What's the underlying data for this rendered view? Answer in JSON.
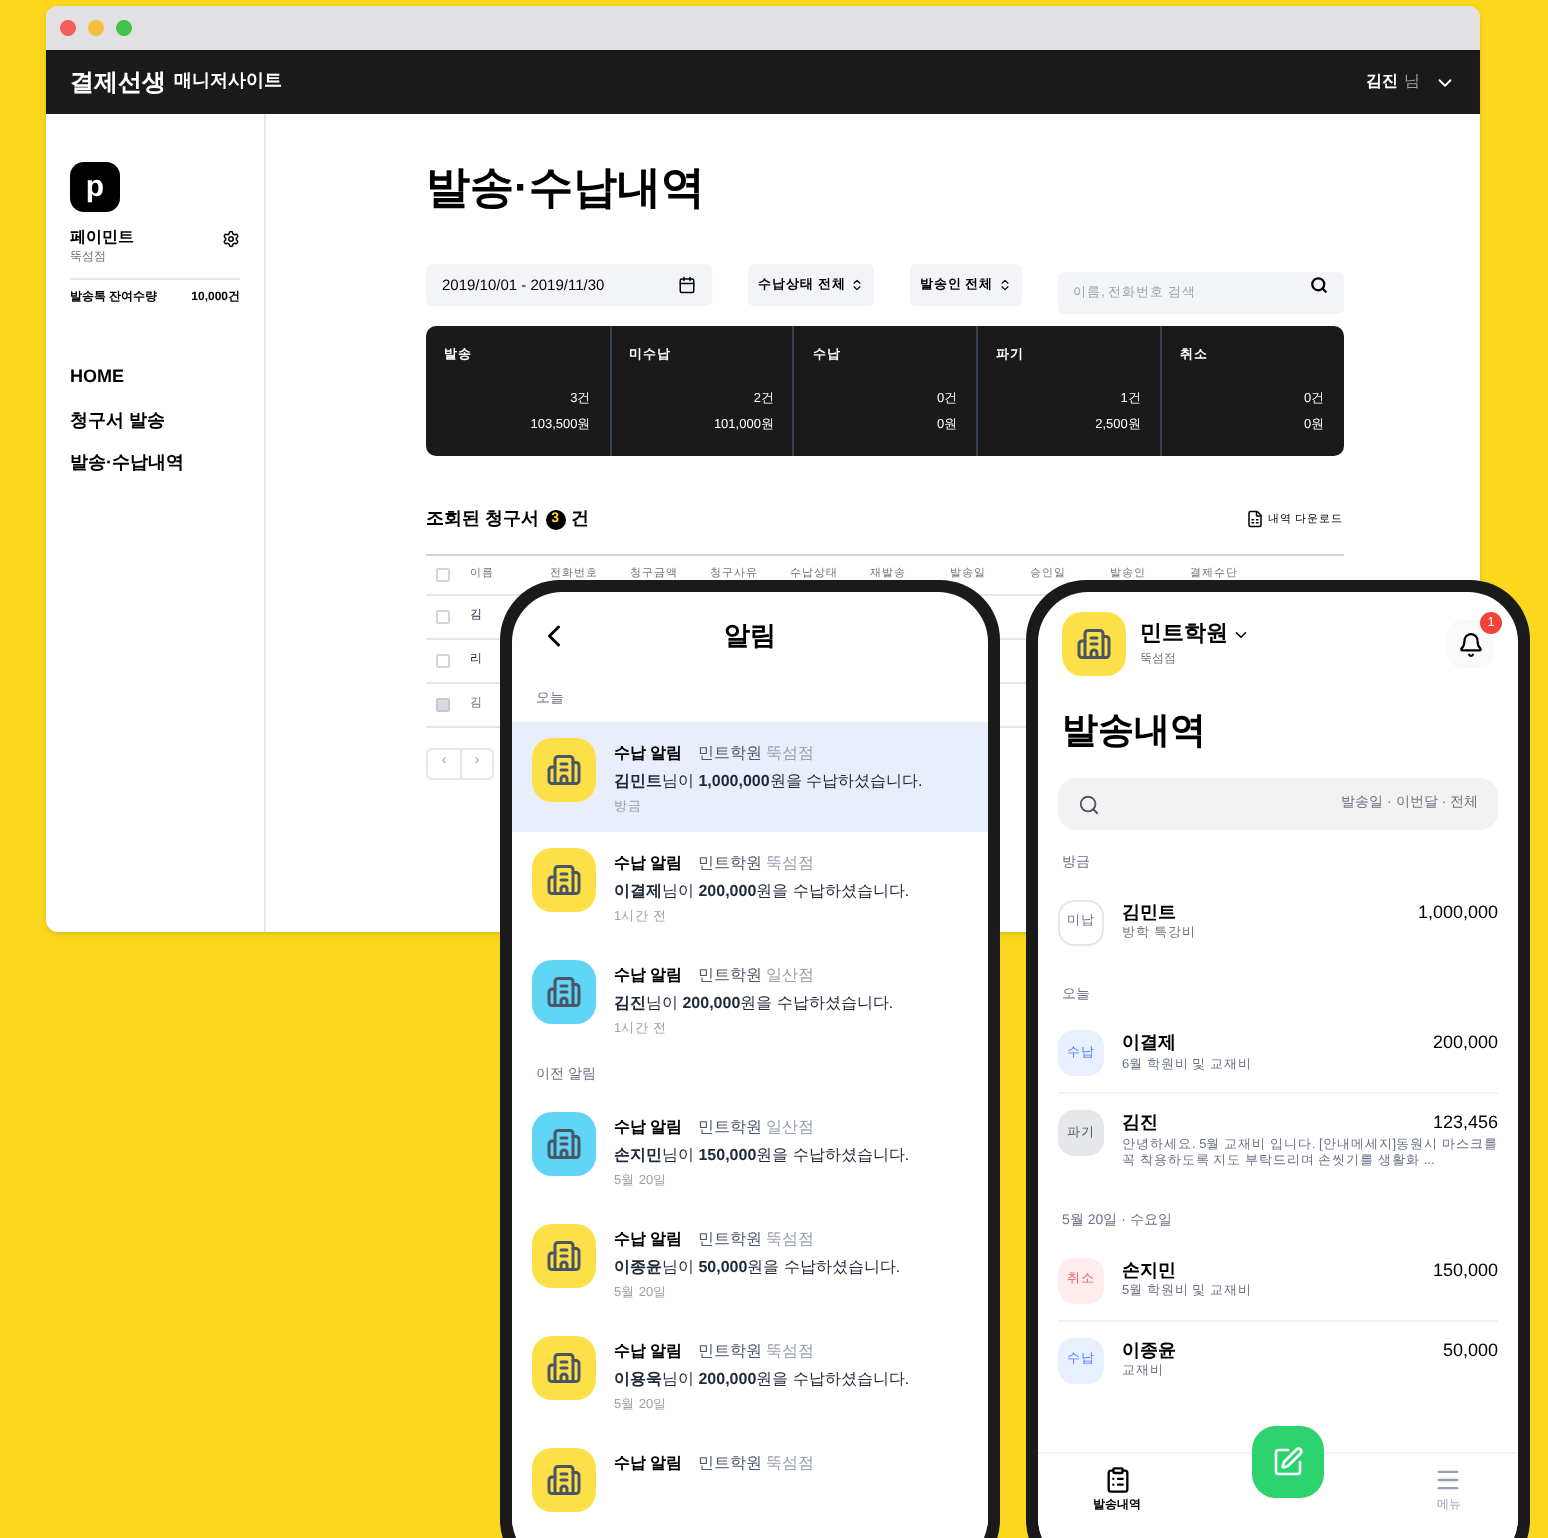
{
  "browser": {
    "brand": "결제선생",
    "site": "매니저사이트",
    "user_name": "김진",
    "user_suffix": "님"
  },
  "sidebar": {
    "org": "페이민트",
    "branch": "뚝섬점",
    "balance_label": "발송톡 잔여수량",
    "balance": "10,000건",
    "logo_letter": "p",
    "nav": [
      "HOME",
      "청구서 발송",
      "발송·수납내역"
    ]
  },
  "page": {
    "title": "발송·수납내역",
    "date_range": "2019/10/01 - 2019/11/30",
    "filters": [
      "수납상태 전체",
      "발송인 전체"
    ],
    "search_placeholder": "이름, 전화번호 검색",
    "summary": [
      {
        "label": "발송",
        "count": "3건",
        "amount": "103,500원"
      },
      {
        "label": "미수납",
        "count": "2건",
        "amount": "101,000원"
      },
      {
        "label": "수납",
        "count": "0건",
        "amount": "0원"
      },
      {
        "label": "파기",
        "count": "1건",
        "amount": "2,500원"
      },
      {
        "label": "취소",
        "count": "0건",
        "amount": "0원"
      }
    ],
    "result_prefix": "조회된 청구서",
    "result_count": "3",
    "result_suffix": "건",
    "download": "내역 다운로드",
    "select_all_checked": false,
    "columns": [
      "이름",
      "전화번호",
      "청구금액",
      "청구사유",
      "수납상태",
      "재발송",
      "발송일",
      "승인일",
      "발송인",
      "결제수단"
    ],
    "rows": [
      {
        "cell": "김",
        "disabled": false
      },
      {
        "cell": "리",
        "disabled": false
      },
      {
        "cell": "김",
        "disabled": true
      }
    ],
    "pager": [
      "‹",
      "›"
    ]
  },
  "notifications": {
    "title": "알림",
    "sections": [
      {
        "label": "오늘",
        "items": [
          {
            "kind": "수납 알림",
            "org": "민트학원",
            "branch": "뚝섬점",
            "message": "**김민트**님이 **1,000,000**원을 수납하셨습니다.",
            "time": "방금",
            "color": "#fde047",
            "selected": true
          },
          {
            "kind": "수납 알림",
            "org": "민트학원",
            "branch": "뚝섬점",
            "message": "**이결제**님이 **200,000**원을 수납하셨습니다.",
            "time": "1시간 전",
            "color": "#fde047",
            "selected": false
          },
          {
            "kind": "수납 알림",
            "org": "민트학원",
            "branch": "일산점",
            "message": "**김진**님이 **200,000**원을 수납하셨습니다.",
            "time": "1시간 전",
            "color": "#5fd4f5",
            "selected": false
          }
        ]
      },
      {
        "label": "이전 알림",
        "items": [
          {
            "kind": "수납 알림",
            "org": "민트학원",
            "branch": "일산점",
            "message": "**손지민**님이 **150,000**원을 수납하셨습니다.",
            "time": "5월 20일",
            "color": "#5fd4f5",
            "selected": false
          },
          {
            "kind": "수납 알림",
            "org": "민트학원",
            "branch": "뚝섬점",
            "message": "**이종윤**님이 **50,000**원을 수납하셨습니다.",
            "time": "5월 20일",
            "color": "#fde047",
            "selected": false
          },
          {
            "kind": "수납 알림",
            "org": "민트학원",
            "branch": "뚝섬점",
            "message": "**이용욱**님이 **200,000**원을 수납하셨습니다.",
            "time": "5월 20일",
            "color": "#fde047",
            "selected": false
          },
          {
            "kind": "수납 알림",
            "org": "민트학원",
            "branch": "뚝섬점",
            "color": "#fde047",
            "selected": false
          }
        ]
      }
    ]
  },
  "history": {
    "org": "민트학원",
    "branch": "뚝섬점",
    "badge": "1",
    "title": "발송내역",
    "filter_text": "발송일 · 이번달 · 전체",
    "groups": [
      {
        "label": "방금",
        "items": [
          {
            "status": "미납",
            "kind": "unpaid",
            "name": "김민트",
            "desc": "방학 특강비",
            "amount": "1,000,000"
          }
        ]
      },
      {
        "label": "오늘",
        "items": [
          {
            "status": "수납",
            "kind": "paid",
            "name": "이결제",
            "desc": "6월 학원비 및 교재비",
            "amount": "200,000"
          },
          {
            "status": "파기",
            "kind": "discarded",
            "name": "김진",
            "desc": "안녕하세요. 5월 교재비 입니다. [안내메세지]동원시 마스크를 꼭 착용하도록 지도 부탁드리며 손씻기를 생활화 ...",
            "amount": "123,456"
          }
        ]
      },
      {
        "label": "5월 20일 · 수요일",
        "items": [
          {
            "status": "취소",
            "kind": "cancelled",
            "name": "손지민",
            "desc": "5월 학원비 및 교재비",
            "amount": "150,000"
          },
          {
            "status": "수납",
            "kind": "paid",
            "name": "이종윤",
            "desc": "교재비",
            "amount": "50,000"
          }
        ]
      }
    ],
    "tabs": [
      {
        "label": "발송내역",
        "selected": true
      },
      {
        "label": "메뉴",
        "selected": false
      }
    ]
  }
}
